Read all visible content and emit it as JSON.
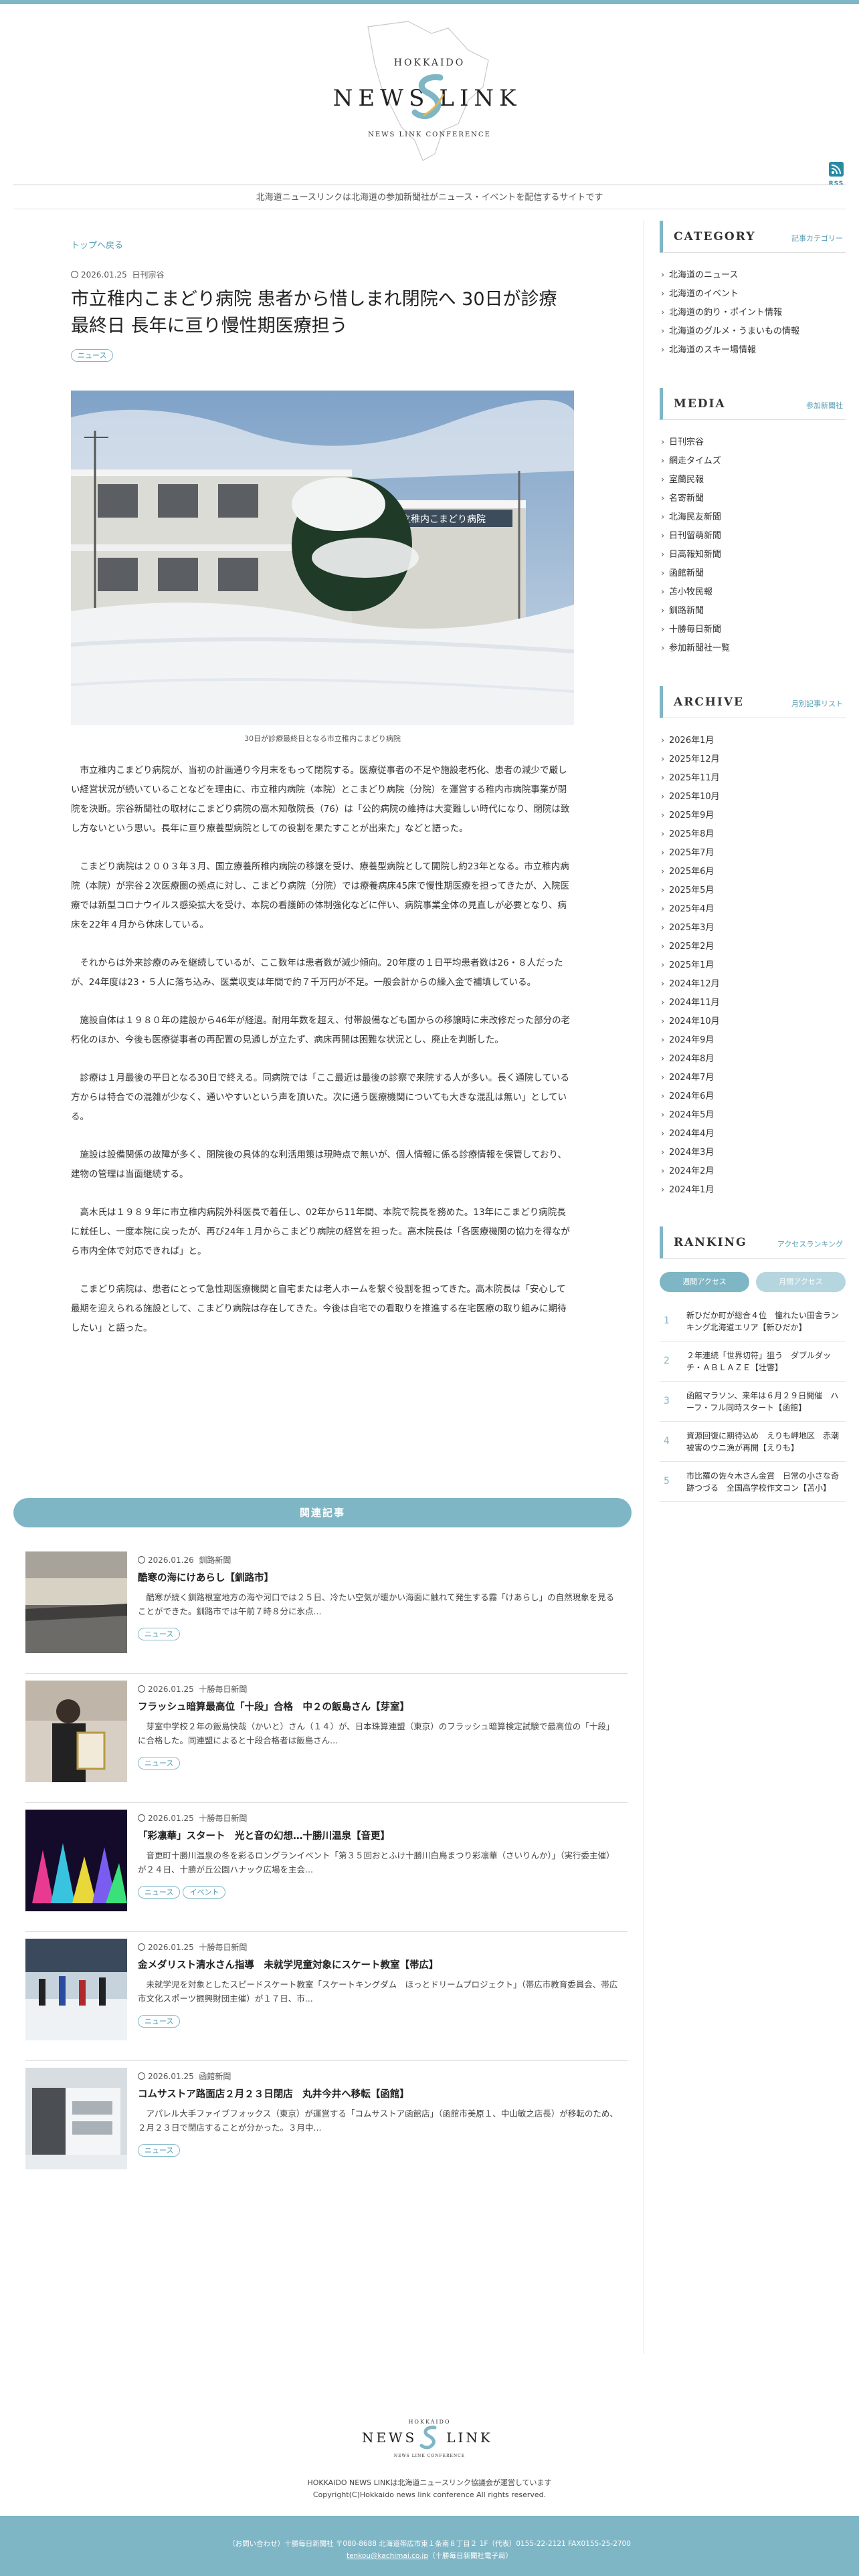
{
  "brand": {
    "logo_top": "HOKKAIDO",
    "logo_left": "NEWS",
    "logo_right": "LINK",
    "logo_sub": "NEWS LINK CONFERENCE",
    "rss": "RSS",
    "tagline": "北海道ニュースリンクは北海道の参加新聞社がニュース・イベントを配信するサイトです",
    "accent": "#7fb6c6"
  },
  "article": {
    "breadcrumb": "トップへ戻る",
    "date": "2026.01.25",
    "source": "日刊宗谷",
    "title": "市立稚内こまどり病院 患者から惜しまれ閉院へ 30日が診療最終日 長年に亘り慢性期医療担う",
    "tag": "ニュース",
    "photo_sign": "市立稚内こまどり病院",
    "caption": "30日が診療最終日となる市立稚内こまどり病院",
    "paragraphs": [
      "市立稚内こまどり病院が、当初の計画通り今月末をもって閉院する。医療従事者の不足や施設老朽化、患者の減少で厳しい経営状況が続いていることなどを理由に、市立稚内病院（本院）とこまどり病院（分院）を運営する稚内市病院事業が閉院を決断。宗谷新聞社の取材にこまどり病院の高木知敬院長（76）は「公的病院の維持は大変難しい時代になり、閉院は致し方ないという思い。長年に亘り療養型病院としての役割を果たすことが出来た」などと語った。",
      "こまどり病院は２００３年３月、国立療養所稚内病院の移譲を受け、療養型病院として開院し約23年となる。市立稚内病院（本院）が宗谷２次医療圏の拠点に対し、こまどり病院（分院）では療養病床45床で慢性期医療を担ってきたが、入院医療では新型コロナウイルス感染拡大を受け、本院の看護師の体制強化などに伴い、病院事業全体の見直しが必要となり、病床を22年４月から休床している。",
      "それからは外来診療のみを継続しているが、ここ数年は患者数が減少傾向。20年度の１日平均患者数は26・８人だったが、24年度は23・５人に落ち込み、医業収支は年間で約７千万円が不足。一般会計からの繰入金で補填している。",
      "施設自体は１９８０年の建設から46年が経過。耐用年数を超え、付帯設備なども国からの移譲時に未改修だった部分の老朽化のほか、今後も医療従事者の再配置の見通しが立たず、病床再開は困難な状況とし、廃止を判断した。",
      "診療は１月最後の平日となる30日で終える。同病院では「ここ最近は最後の診察で来院する人が多い。長く通院している方からは特合での混雑が少なく、通いやすいという声を頂いた。次に通う医療機関についても大きな混乱は無い」としている。",
      "施設は設備関係の故障が多く、閉院後の具体的な利活用策は現時点で無いが、個人情報に係る診療情報を保管しており、建物の管理は当面継続する。",
      "高木氏は１９８９年に市立稚内病院外科医長で着任し、02年から11年間、本院で院長を務めた。13年にこまどり病院長に就任し、一度本院に戻ったが、再び24年１月からこまどり病院の経営を担った。高木院長は「各医療機関の協力を得ながら市内全体で対応できれば」と。",
      "こまどり病院は、患者にとって急性期医療機関と自宅または老人ホームを繋ぐ役割を担ってきた。高木院長は「安心して最期を迎えられる施設として、こまどり病院は存在してきた。今後は自宅での看取りを推進する在宅医療の取り組みに期待したい」と語った。"
    ]
  },
  "related": {
    "heading": "関連記事",
    "items": [
      {
        "date": "2026.01.26",
        "source": "釧路新聞",
        "title": "酷寒の海にけあらし【釧路市】",
        "excerpt": "酷寒が続く釧路根室地方の海や河口では２５日、冷たい空気が暖かい海面に触れて発生する霧「けあらし」の自然現象を見ることができた。釧路市では午前７時８分に氷点...",
        "tags": [
          "ニュース"
        ]
      },
      {
        "date": "2026.01.25",
        "source": "十勝毎日新聞",
        "title": "フラッシュ暗算最高位「十段」合格　中２の飯島さん【芽室】",
        "excerpt": "芽室中学校２年の飯島快哉（かいと）さん（１４）が、日本珠算連盟（東京）のフラッシュ暗算検定試験で最高位の「十段」に合格した。同連盟によると十段合格者は飯島さん...",
        "tags": [
          "ニュース"
        ]
      },
      {
        "date": "2026.01.25",
        "source": "十勝毎日新聞",
        "title": "「彩凛華」スタート　光と音の幻想…十勝川温泉【音更】",
        "excerpt": "音更町十勝川温泉の冬を彩るロングランイベント「第３５回おとふけ十勝川白鳥まつり彩凛華（さいりんか）」（実行委主催）が２４日、十勝が丘公園ハナック広場を主会...",
        "tags": [
          "ニュース",
          "イベント"
        ]
      },
      {
        "date": "2026.01.25",
        "source": "十勝毎日新聞",
        "title": "金メダリスト清水さん指導　未就学児童対象にスケート教室【帯広】",
        "excerpt": "未就学児を対象としたスピードスケート教室「スケートキングダム　ほっとドリームプロジェクト」（帯広市教育委員会、帯広市文化スポーツ振興財団主催）が１７日、市...",
        "tags": [
          "ニュース"
        ]
      },
      {
        "date": "2026.01.25",
        "source": "函館新聞",
        "title": "コムサストア路面店２月２３日閉店　丸井今井へ移転【函館】",
        "excerpt": "アパレル大手ファイブフォックス（東京）が運営する「コムサストア函館店」（函館市美原１、中山敏之店長）が移転のため、２月２３日で閉店することが分かった。３月中...",
        "tags": [
          "ニュース"
        ]
      }
    ]
  },
  "sidebar": {
    "category": {
      "title": "CATEGORY",
      "sub": "記事カテゴリー",
      "items": [
        "北海道のニュース",
        "北海道のイベント",
        "北海道の釣り・ポイント情報",
        "北海道のグルメ・うまいもの情報",
        "北海道のスキー場情報"
      ]
    },
    "media": {
      "title": "MEDIA",
      "sub": "参加新聞社",
      "items": [
        "日刊宗谷",
        "網走タイムズ",
        "室蘭民報",
        "名寄新聞",
        "北海民友新聞",
        "日刊留萌新聞",
        "日高報知新聞",
        "函館新聞",
        "苫小牧民報",
        "釧路新聞",
        "十勝毎日新聞",
        "参加新聞社一覧"
      ]
    },
    "archive": {
      "title": "ARCHIVE",
      "sub": "月別記事リスト",
      "items": [
        "2026年1月",
        "2025年12月",
        "2025年11月",
        "2025年10月",
        "2025年9月",
        "2025年8月",
        "2025年7月",
        "2025年6月",
        "2025年5月",
        "2025年4月",
        "2025年3月",
        "2025年2月",
        "2025年1月",
        "2024年12月",
        "2024年11月",
        "2024年10月",
        "2024年9月",
        "2024年8月",
        "2024年7月",
        "2024年6月",
        "2024年5月",
        "2024年4月",
        "2024年3月",
        "2024年2月",
        "2024年1月"
      ]
    },
    "ranking": {
      "title": "RANKING",
      "sub": "アクセスランキング",
      "tab_week": "週間アクセス",
      "tab_month": "月間アクセス",
      "items": [
        {
          "num": "1",
          "text": "新ひだか町が総合４位　憧れたい田舎ランキング北海道エリア【新ひだか】"
        },
        {
          "num": "2",
          "text": "２年連続「世界切符」狙う　ダブルダッチ・ＡＢＬＡＺＥ【壮瞥】"
        },
        {
          "num": "3",
          "text": "函館マラソン、来年は６月２９日開催　ハーフ・フル同時スタート【函館】"
        },
        {
          "num": "4",
          "text": "資源回復に期待込め　えりも岬地区　赤潮被害のウニ漁が再開【えりも】"
        },
        {
          "num": "5",
          "text": "市比羅の佐々木さん金賞　日常の小さな奇跡つづる　全国高学校作文コン【苫小】"
        }
      ]
    }
  },
  "footer": {
    "line1": "HOKKAIDO NEWS LINKは北海道ニュースリンク協議会が運営しています",
    "line2": "Copyright(C)Hokkaido news link conference All rights reserved.",
    "contact": "（お問い合わせ）十勝毎日新聞社 〒080-8688 北海道帯広市東１条南８丁目２ 1F（代表）0155-22-2121 FAX0155-25-2700",
    "email": "tenkou@kachimai.co.jp",
    "email_note": "（十勝毎日新聞社電子局）"
  }
}
